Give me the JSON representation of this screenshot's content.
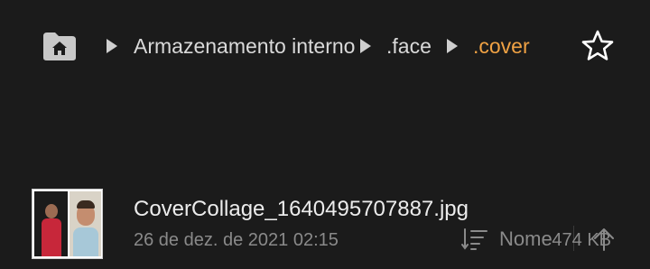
{
  "breadcrumb": {
    "items": [
      {
        "label": "Armazenamento interno",
        "active": false
      },
      {
        "label": ".face",
        "active": false
      },
      {
        "label": ".cover",
        "active": true
      }
    ],
    "active_color": "#f0a244",
    "icons": {
      "home": "home-folder-icon",
      "separator": "triangle-right-icon",
      "favorite": "star-outline-icon"
    }
  },
  "sort": {
    "label": "Nome",
    "icons": {
      "sort": "sort-lines-icon",
      "direction": "arrow-up-icon"
    }
  },
  "files": [
    {
      "name": "CoverCollage_1640495707887.jpg",
      "date": "26 de dez. de 2021 02:15",
      "size": "474 KB",
      "thumbnail": "image-thumbnail"
    }
  ],
  "colors": {
    "background": "#1b1b1b",
    "text": "#e8e8e8",
    "muted": "#8a8a8a"
  }
}
